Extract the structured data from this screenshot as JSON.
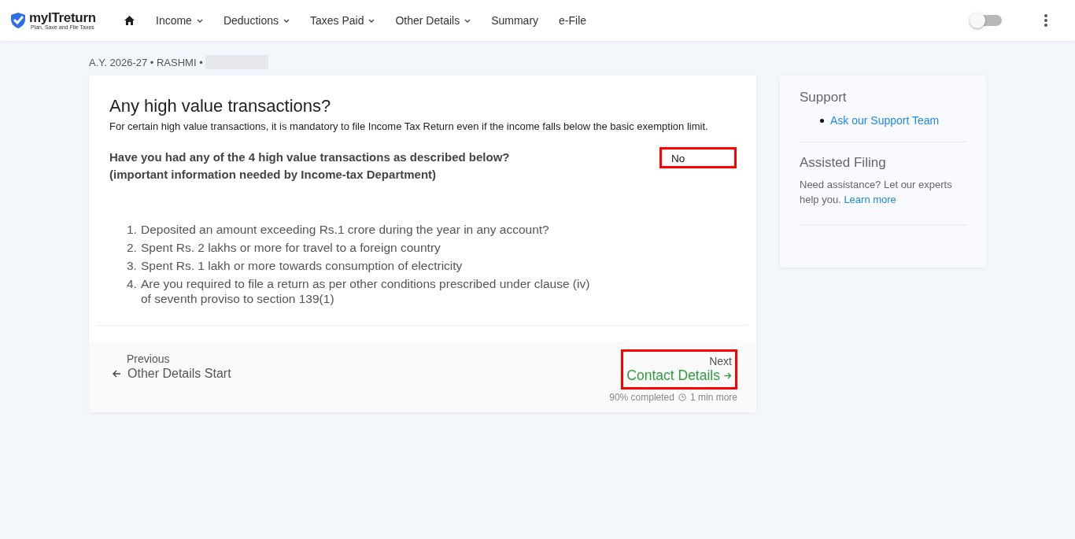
{
  "header": {
    "logo": {
      "name": "myITreturn",
      "tagline": "Plan, Save and File Taxes"
    },
    "nav": [
      {
        "kind": "home"
      },
      {
        "kind": "menu",
        "label": "Income",
        "dropdown": true
      },
      {
        "kind": "menu",
        "label": "Deductions",
        "dropdown": true
      },
      {
        "kind": "menu",
        "label": "Taxes Paid",
        "dropdown": true
      },
      {
        "kind": "menu",
        "label": "Other Details",
        "dropdown": true
      },
      {
        "kind": "menu",
        "label": "Summary",
        "dropdown": false
      },
      {
        "kind": "menu",
        "label": "e-File",
        "dropdown": false
      }
    ],
    "toggle": {
      "on": false
    }
  },
  "breadcrumb": {
    "text": "A.Y. 2026-27 • RASHMI •",
    "redacted": true
  },
  "card": {
    "title": "Any high value transactions?",
    "subtitle": "For certain high value transactions, it is mandatory to file Income Tax Return even if the income falls below the basic exemption limit.",
    "question": {
      "line_1": "Have you had any of the 4 high value transactions as described below?",
      "line_2": "(important information needed by Income-tax Department)",
      "answer": "No",
      "highlighted": true
    },
    "items": [
      {
        "number": "1.",
        "text": "Deposited an amount exceeding Rs.1 crore during the year in any account?"
      },
      {
        "number": "2.",
        "text": "Spent Rs. 2 lakhs or more for travel to a foreign country"
      },
      {
        "number": "3.",
        "text": "Spent Rs. 1 lakh or more towards consumption of electricity"
      },
      {
        "number": "4.",
        "text": "Are you required to file a return as per other conditions prescribed under clause (iv) of seventh proviso to section 139(1)"
      }
    ],
    "footer": {
      "previous_label": "Previous",
      "previous_page": "Other Details Start",
      "next_label": "Next",
      "next_page": "Contact Details",
      "next_highlighted": true,
      "progress": "90% completed",
      "time": "1 min more"
    }
  },
  "sidebar": {
    "support_title": "Support",
    "support_link": "Ask our Support Team",
    "assisted_title": "Assisted Filing",
    "assisted_text": "Need assistance? Let our experts help you.",
    "assisted_link": "Learn more"
  }
}
